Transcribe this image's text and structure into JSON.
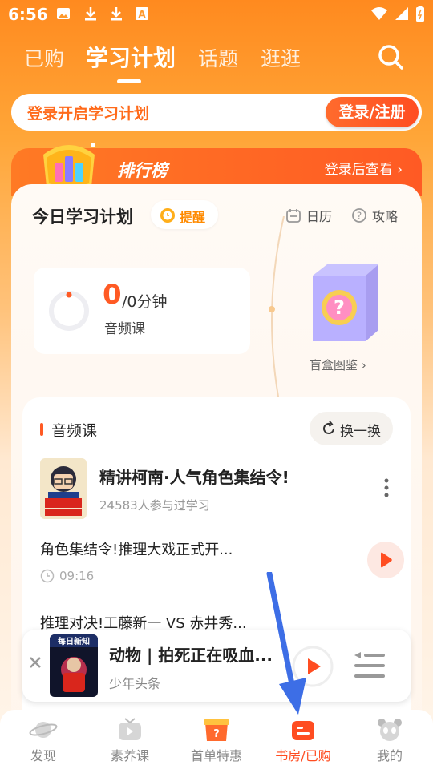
{
  "status_bar": {
    "time": "6:56",
    "left_icons": [
      "image-icon",
      "download-icon",
      "download-icon",
      "font-a-icon"
    ],
    "right_icons": [
      "wifi-icon",
      "signal-icon",
      "battery-icon"
    ]
  },
  "top_tabs": {
    "items": [
      {
        "label": "已购",
        "active": false
      },
      {
        "label": "学习计划",
        "active": true
      },
      {
        "label": "话题",
        "active": false
      },
      {
        "label": "逛逛",
        "active": false
      }
    ],
    "search_icon": "search-icon"
  },
  "login_bar": {
    "prompt": "登录开启学习计划",
    "button": "登录/注册"
  },
  "ranking": {
    "title": "排行榜",
    "action": "登录后查看 ›"
  },
  "plan": {
    "title": "今日学习计划",
    "remind_label": "提醒",
    "calendar_label": "日历",
    "guide_label": "攻略",
    "stat_value": "0",
    "stat_unit": "/0分钟",
    "stat_sub": "音频课",
    "blind_box_label": "盲盒图鉴 ›"
  },
  "course_section": {
    "title": "音频课",
    "swap_label": "换一换",
    "course_title": "精讲柯南·人气角色集结令!",
    "course_meta": "24583人参与过学习",
    "episodes": [
      {
        "title": "角色集结令!推理大戏正式开...",
        "duration": "09:16"
      },
      {
        "title": "推理对决!工藤新一 VS 赤井秀...",
        "duration": ""
      }
    ]
  },
  "mini_player": {
    "cover_text": "每日新知",
    "title": "动物 | 拍死正在吸血...",
    "subtitle": "少年头条"
  },
  "bottom_nav": {
    "items": [
      {
        "label": "发现",
        "icon": "planet-icon",
        "active": false
      },
      {
        "label": "素养课",
        "icon": "tv-icon",
        "active": false
      },
      {
        "label": "首单特惠",
        "icon": "gift-box-icon",
        "active": false
      },
      {
        "label": "书房/已购",
        "icon": "bookshelf-icon",
        "active": true
      },
      {
        "label": "我的",
        "icon": "panda-icon",
        "active": false
      }
    ]
  },
  "colors": {
    "brand_orange": "#ff6a1a",
    "active_red": "#ff4d21",
    "annotation_blue": "#3d6ee6"
  }
}
